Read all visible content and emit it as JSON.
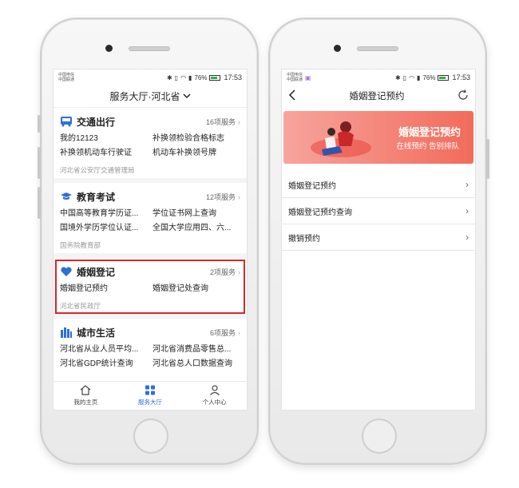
{
  "status_bar": {
    "carrier1": "中国电信",
    "carrier2": "中国联通",
    "battery": "76%",
    "time": "17:53"
  },
  "left": {
    "header_title": "服务大厅·河北省",
    "sections": [
      {
        "title": "交通出行",
        "count": "16项服务",
        "items": [
          "我的12123",
          "补换领检验合格标志",
          "补换领机动车行驶证",
          "机动车补换领号牌"
        ],
        "dept": "河北省公安厅交通管理局",
        "icon": "bus-icon"
      },
      {
        "title": "教育考试",
        "count": "12项服务",
        "items": [
          "中国高等教育学历证...",
          "学位证书网上查询",
          "国境外学历学位认证...",
          "全国大学应用四、六..."
        ],
        "dept": "国务院教育部",
        "icon": "graduation-cap-icon"
      },
      {
        "title": "婚姻登记",
        "count": "2项服务",
        "items": [
          "婚姻登记预约",
          "婚姻登记处查询"
        ],
        "dept": "河北省民政厅",
        "icon": "heart-icon"
      },
      {
        "title": "城市生活",
        "count": "6项服务",
        "items": [
          "河北省从业人员平均...",
          "河北省消费品零售总...",
          "河北省GDP统计查询",
          "河北省总人口数据查询"
        ],
        "icon": "city-icon"
      }
    ],
    "tabs": [
      {
        "label": "我的主页",
        "icon": "home-icon"
      },
      {
        "label": "服务大厅",
        "icon": "grid-icon"
      },
      {
        "label": "个人中心",
        "icon": "person-icon"
      }
    ],
    "active_tab": "服务大厅"
  },
  "right": {
    "nav_title": "婚姻登记预约",
    "banner_title": "婚姻登记预约",
    "banner_sub": "在线预约  告别排队",
    "menu": [
      "婚姻登记预约",
      "婚姻登记预约查询",
      "撤销预约"
    ]
  },
  "colors": {
    "accent_blue": "#2d6fd8",
    "highlight_red": "#d9252a",
    "banner_start": "#f7a49d",
    "banner_end": "#f26b5b"
  }
}
